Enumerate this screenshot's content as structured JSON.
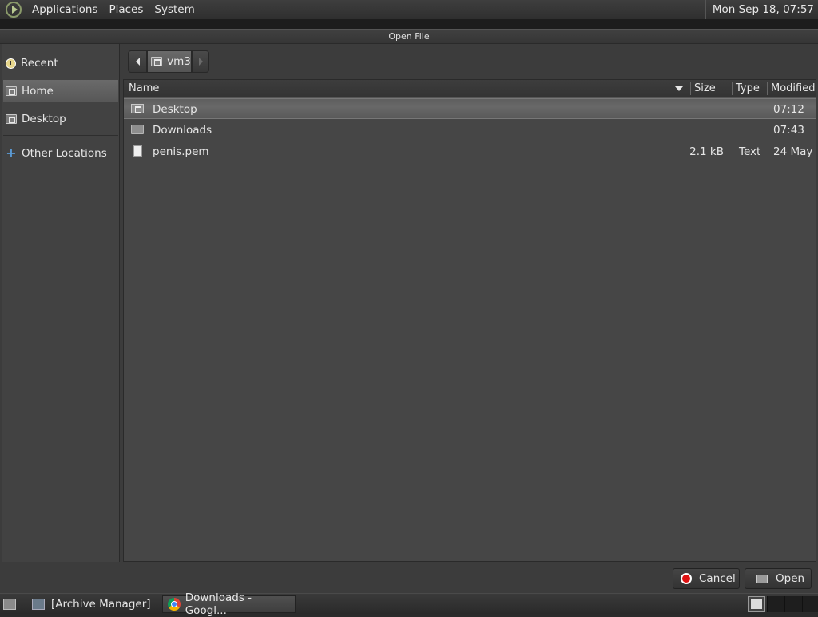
{
  "top_panel": {
    "menus": [
      "Applications",
      "Places",
      "System"
    ],
    "clock": "Mon Sep 18, 07:57"
  },
  "dialog": {
    "title": "Open File",
    "sidebar": {
      "items": [
        {
          "label": "Recent",
          "icon": "clock-icon"
        },
        {
          "label": "Home",
          "icon": "home-folder-icon",
          "active": true
        },
        {
          "label": "Desktop",
          "icon": "desktop-folder-icon"
        },
        {
          "label": "Other Locations",
          "icon": "plus-icon"
        }
      ]
    },
    "path": {
      "current": "vm3"
    },
    "columns": {
      "name": "Name",
      "size": "Size",
      "type": "Type",
      "modified": "Modified"
    },
    "files": [
      {
        "name": "Desktop",
        "size": "",
        "type": "",
        "modified": "07:12",
        "icon": "desktop-folder-icon",
        "selected": true
      },
      {
        "name": "Downloads",
        "size": "",
        "type": "",
        "modified": "07:43",
        "icon": "folder-icon"
      },
      {
        "name": "penis.pem",
        "size": "2.1 kB",
        "type": "Text",
        "modified": "24 May",
        "icon": "file-icon"
      }
    ],
    "buttons": {
      "cancel": "Cancel",
      "open": "Open"
    }
  },
  "taskbar": {
    "tasks": [
      {
        "label": "[Archive Manager]",
        "icon": "archive-manager-icon"
      },
      {
        "label": "Downloads - Googl...",
        "icon": "chrome-icon",
        "active": true
      }
    ]
  }
}
